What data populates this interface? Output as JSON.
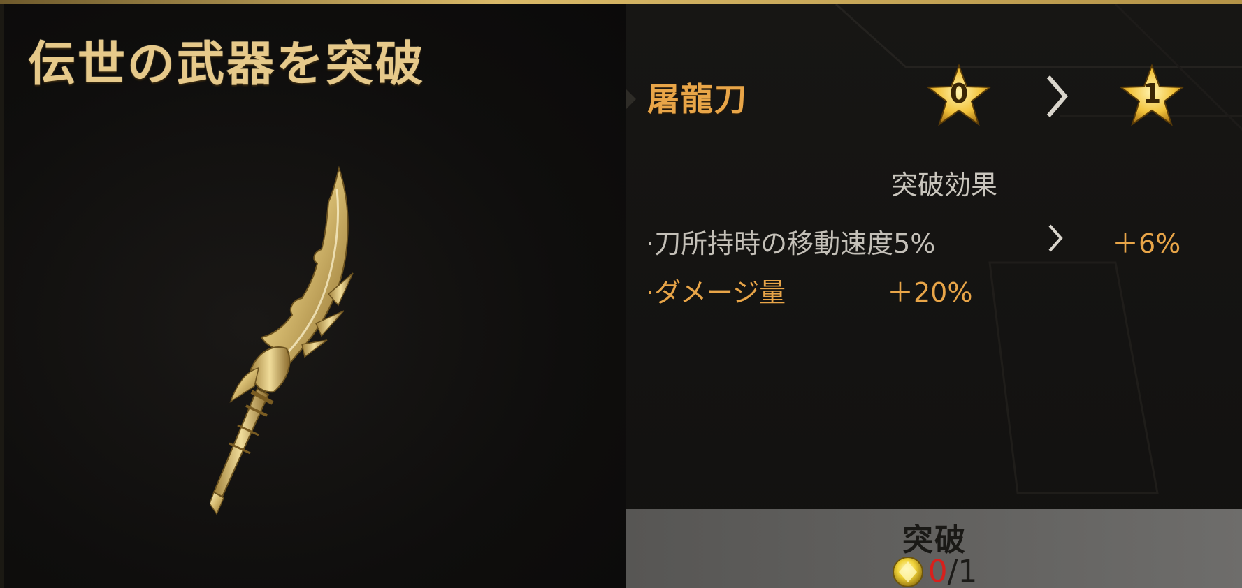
{
  "header": {
    "title": "伝世の武器を突破"
  },
  "weapon": {
    "name": "屠龍刀",
    "image_icon": "golden-dragon-saber"
  },
  "stars": {
    "from": "0",
    "to": "1",
    "icon": "star-icon"
  },
  "section": {
    "title": "突破効果"
  },
  "effects": [
    {
      "label": "·刀所持時の移動速度5%",
      "value": "＋6%"
    },
    {
      "label": "·ダメージ量",
      "value": "＋20%"
    }
  ],
  "action": {
    "label": "突破",
    "cost_have": "0",
    "cost_separator": "/",
    "cost_need": "1",
    "cost_icon": "gem-coin-icon"
  },
  "colors": {
    "title_gold": "#e6c98a",
    "accent_orange": "#e8a548",
    "cost_red": "#d7201c",
    "button_gray": "#646361"
  }
}
